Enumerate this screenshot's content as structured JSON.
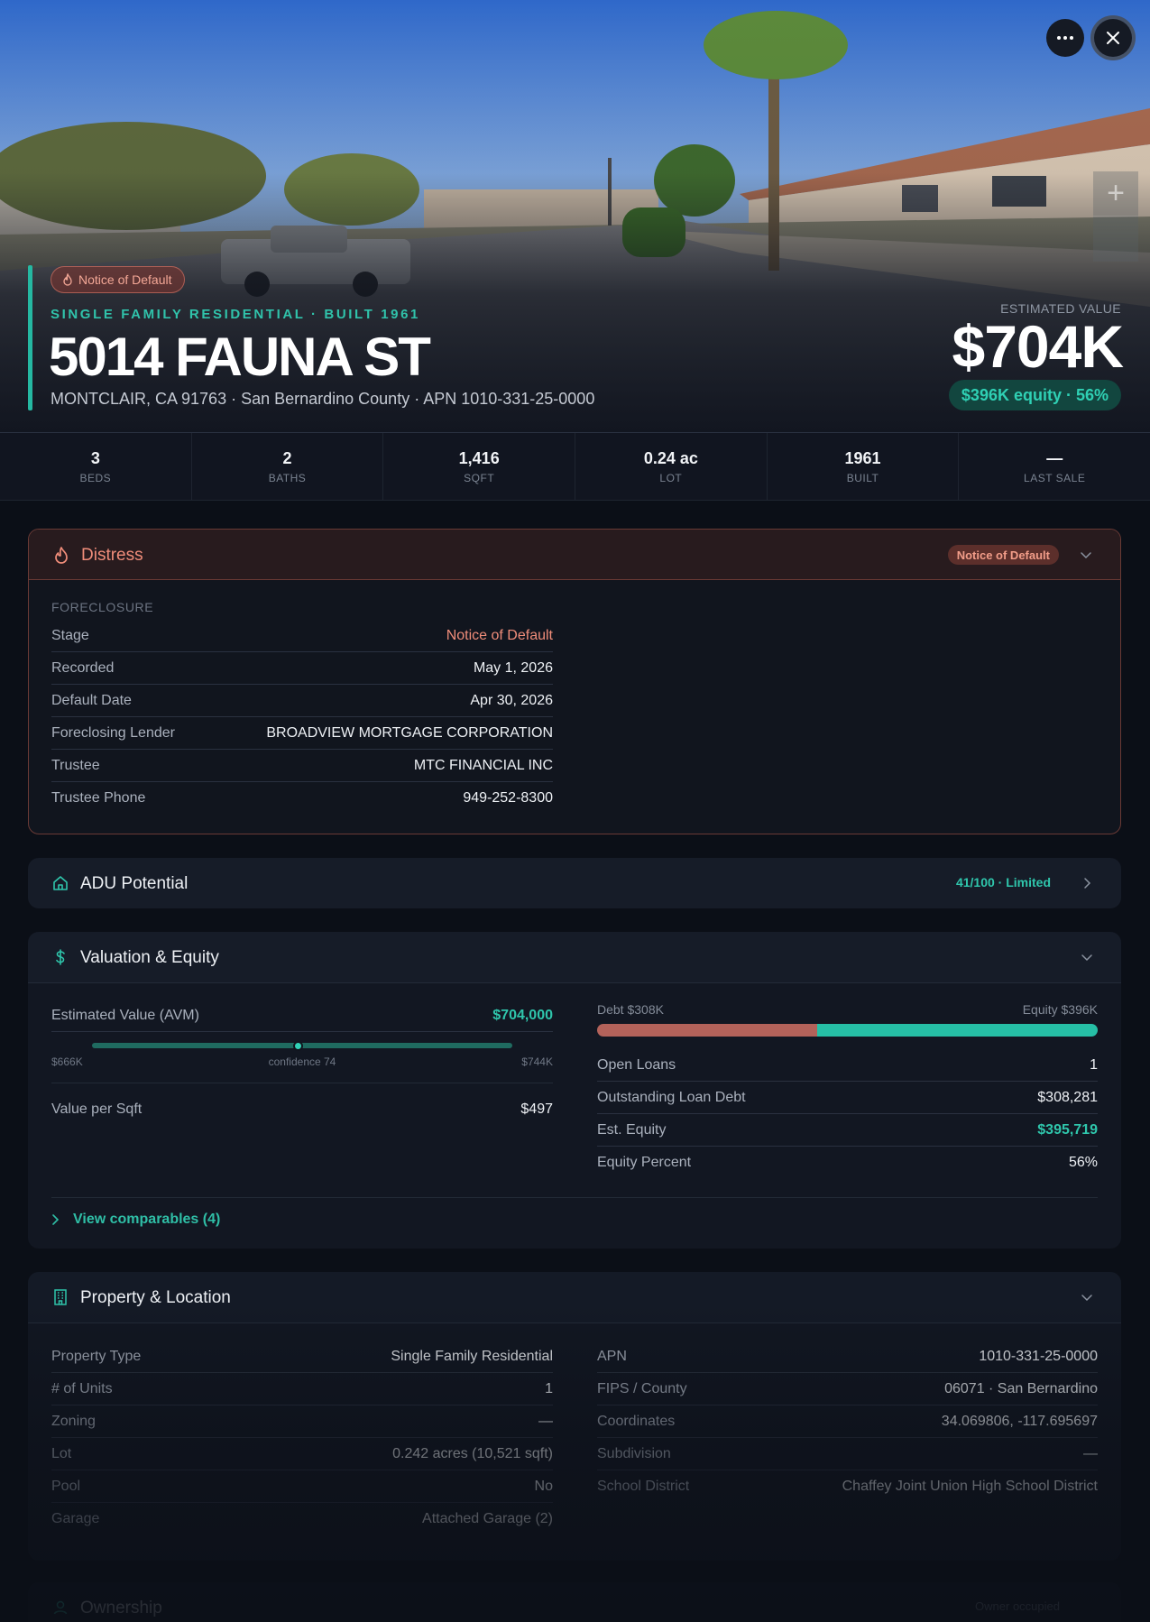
{
  "hero": {
    "badge": "Notice of Default",
    "property_type_line": "SINGLE FAMILY RESIDENTIAL · BUILT 1961",
    "address": "5014 FAUNA ST",
    "location_line": "MONTCLAIR, CA 91763 · San Bernardino County · APN 1010-331-25-0000",
    "estimated_value_label": "ESTIMATED VALUE",
    "estimated_value": "$704K",
    "equity_chip": "$396K equity · 56%"
  },
  "stats": [
    {
      "value": "3",
      "label": "BEDS"
    },
    {
      "value": "2",
      "label": "BATHS"
    },
    {
      "value": "1,416",
      "label": "SQFT"
    },
    {
      "value": "0.24 ac",
      "label": "LOT"
    },
    {
      "value": "1961",
      "label": "BUILT"
    },
    {
      "value": "—",
      "label": "LAST SALE"
    }
  ],
  "distress": {
    "title": "Distress",
    "badge": "Notice of Default",
    "section_label": "FORECLOSURE",
    "rows": [
      {
        "k": "Stage",
        "v": "Notice of Default"
      },
      {
        "k": "Recorded",
        "v": "May 1, 2026"
      },
      {
        "k": "Default Date",
        "v": "Apr 30, 2026"
      },
      {
        "k": "Foreclosing Lender",
        "v": "BROADVIEW MORTGAGE CORPORATION"
      },
      {
        "k": "Trustee",
        "v": "MTC FINANCIAL INC"
      },
      {
        "k": "Trustee Phone",
        "v": "949-252-8300"
      }
    ]
  },
  "adu": {
    "title": "ADU Potential",
    "score": "41/100 · Limited"
  },
  "valuation": {
    "title": "Valuation & Equity",
    "avm_label": "Estimated Value (AVM)",
    "avm_value": "$704,000",
    "range_low": "$666K",
    "confidence": "confidence 74",
    "range_high": "$744K",
    "avm_position_fraction": 0.49,
    "value_per_sqft_label": "Value per Sqft",
    "value_per_sqft": "$497",
    "debt_label": "Debt $308K",
    "equity_label": "Equity $396K",
    "debt_fraction": 0.44,
    "rows": [
      {
        "k": "Open Loans",
        "v": "1"
      },
      {
        "k": "Outstanding Loan Debt",
        "v": "$308,281"
      },
      {
        "k": "Est. Equity",
        "v": "$395,719"
      },
      {
        "k": "Equity Percent",
        "v": "56%"
      }
    ],
    "comps_link": "View comparables (4)"
  },
  "property": {
    "title": "Property & Location",
    "left_rows": [
      {
        "k": "Property Type",
        "v": "Single Family Residential"
      },
      {
        "k": "# of Units",
        "v": "1"
      },
      {
        "k": "Zoning",
        "v": "—"
      },
      {
        "k": "Lot",
        "v": "0.242 acres (10,521 sqft)"
      },
      {
        "k": "Pool",
        "v": "No"
      },
      {
        "k": "Garage",
        "v": "Attached Garage (2)"
      }
    ],
    "right_rows": [
      {
        "k": "APN",
        "v": "1010-331-25-0000"
      },
      {
        "k": "FIPS / County",
        "v": "06071 · San Bernardino"
      },
      {
        "k": "Coordinates",
        "v": "34.069806, -117.695697"
      },
      {
        "k": "Subdivision",
        "v": "—"
      },
      {
        "k": "School District",
        "v": "Chaffey Joint Union High School District"
      }
    ]
  },
  "ownership": {
    "title": "Ownership",
    "badge": "Owner occupied"
  },
  "colors": {
    "accent": "#2fc6ac",
    "distress": "#f08d7a",
    "debt": "#b3625a",
    "background": "#0b0f17"
  }
}
